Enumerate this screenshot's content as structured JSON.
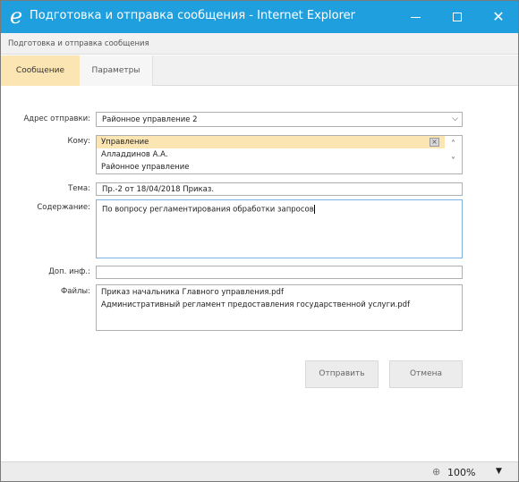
{
  "window": {
    "title": "Подготовка и отправка сообщения - Internet Explorer",
    "logo_glyph": "e",
    "minimize_icon": "minimize-icon",
    "maximize_icon": "maximize-icon",
    "close_icon": "close-icon",
    "close_glyph": "✕"
  },
  "subtitle": "Подготовка и отправка сообщения",
  "tabs": [
    {
      "label": "Сообщение",
      "active": true
    },
    {
      "label": "Параметры",
      "active": false
    }
  ],
  "form": {
    "from_label": "Адрес отправки:",
    "from_value": "Районное управление 2",
    "to_label": "Кому:",
    "to_items": [
      "Управление",
      "Алладдинов А.А.",
      "Районное управление"
    ],
    "to_remove_glyph": "×",
    "subject_label": "Тема:",
    "subject_value": "Пр.-2 от 18/04/2018 Приказ.",
    "content_label": "Содержание:",
    "content_value": "По вопросу регламентирования обработки запросов",
    "extra_label": "Доп. инф.:",
    "extra_value": "",
    "files_label": "Файлы:",
    "files": [
      "Приказ начальника Главного управления.pdf",
      "Административный регламент предоставления государственной услуги.pdf"
    ]
  },
  "buttons": {
    "send": "Отправить",
    "cancel": "Отмена"
  },
  "status": {
    "zoom": "100%",
    "zoom_glyph": "⊕",
    "dropdown_glyph": "▼"
  },
  "colors": {
    "titlebar": "#1f9fde",
    "active_tab": "#fbe6b3",
    "selected_row": "#fbe6b3"
  }
}
